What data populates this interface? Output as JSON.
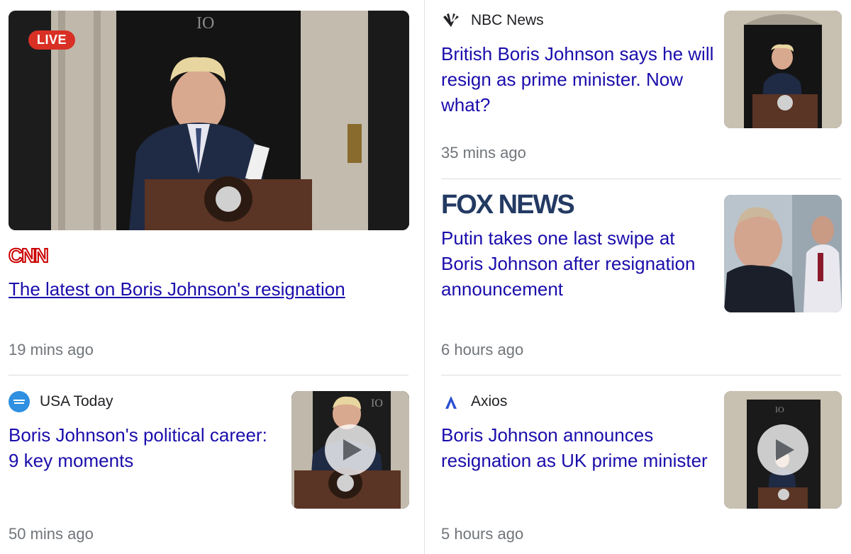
{
  "cards": {
    "main": {
      "badge": "LIVE",
      "source": "CNN",
      "headline": "The latest on Boris Johnson's resignation",
      "time": "19 mins ago"
    },
    "nbc": {
      "source": "NBC News",
      "headline": "British Boris Johnson says he will resign as prime minister. Now what?",
      "time": "35 mins ago"
    },
    "fox": {
      "source": "FOX NEWS",
      "headline": "Putin takes one last swipe at Boris Johnson after resignation announcement",
      "time": "6 hours ago"
    },
    "usa": {
      "source": "USA Today",
      "headline": "Boris Johnson's political career: 9 key moments",
      "time": "50 mins ago"
    },
    "axios": {
      "source": "Axios",
      "headline": "Boris Johnson announces resignation as UK prime minister",
      "time": "5 hours ago"
    }
  },
  "icons": {
    "nbc": "nbc-peacock-icon",
    "usa": "usa-today-logo-icon",
    "axios": "axios-logo-icon",
    "play": "play-icon"
  },
  "colors": {
    "link": "#1a0dab",
    "meta": "#70757a",
    "live": "#d93025"
  }
}
